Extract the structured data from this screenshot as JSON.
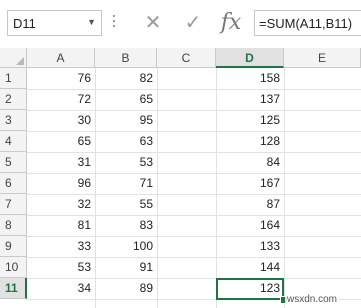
{
  "name_box": {
    "value": "D11",
    "dropdown_icon": "chevron-down-icon"
  },
  "formula_bar": {
    "cancel_icon": "close-icon",
    "enter_icon": "check-icon",
    "fx_label": "fx",
    "formula": "=SUM(A11,B11)"
  },
  "columns": [
    "A",
    "B",
    "C",
    "D",
    "E"
  ],
  "active_column": "D",
  "active_row": "11",
  "rows": [
    {
      "row": "1",
      "a": "76",
      "b": "82",
      "d": "158"
    },
    {
      "row": "2",
      "a": "72",
      "b": "65",
      "d": "137"
    },
    {
      "row": "3",
      "a": "30",
      "b": "95",
      "d": "125"
    },
    {
      "row": "4",
      "a": "65",
      "b": "63",
      "d": "128"
    },
    {
      "row": "5",
      "a": "31",
      "b": "53",
      "d": "84"
    },
    {
      "row": "6",
      "a": "96",
      "b": "71",
      "d": "167"
    },
    {
      "row": "7",
      "a": "32",
      "b": "55",
      "d": "87"
    },
    {
      "row": "8",
      "a": "81",
      "b": "83",
      "d": "164"
    },
    {
      "row": "9",
      "a": "33",
      "b": "100",
      "d": "133"
    },
    {
      "row": "10",
      "a": "53",
      "b": "91",
      "d": "144"
    },
    {
      "row": "11",
      "a": "34",
      "b": "89",
      "d": "123"
    }
  ],
  "watermark": "wsxdn.com"
}
